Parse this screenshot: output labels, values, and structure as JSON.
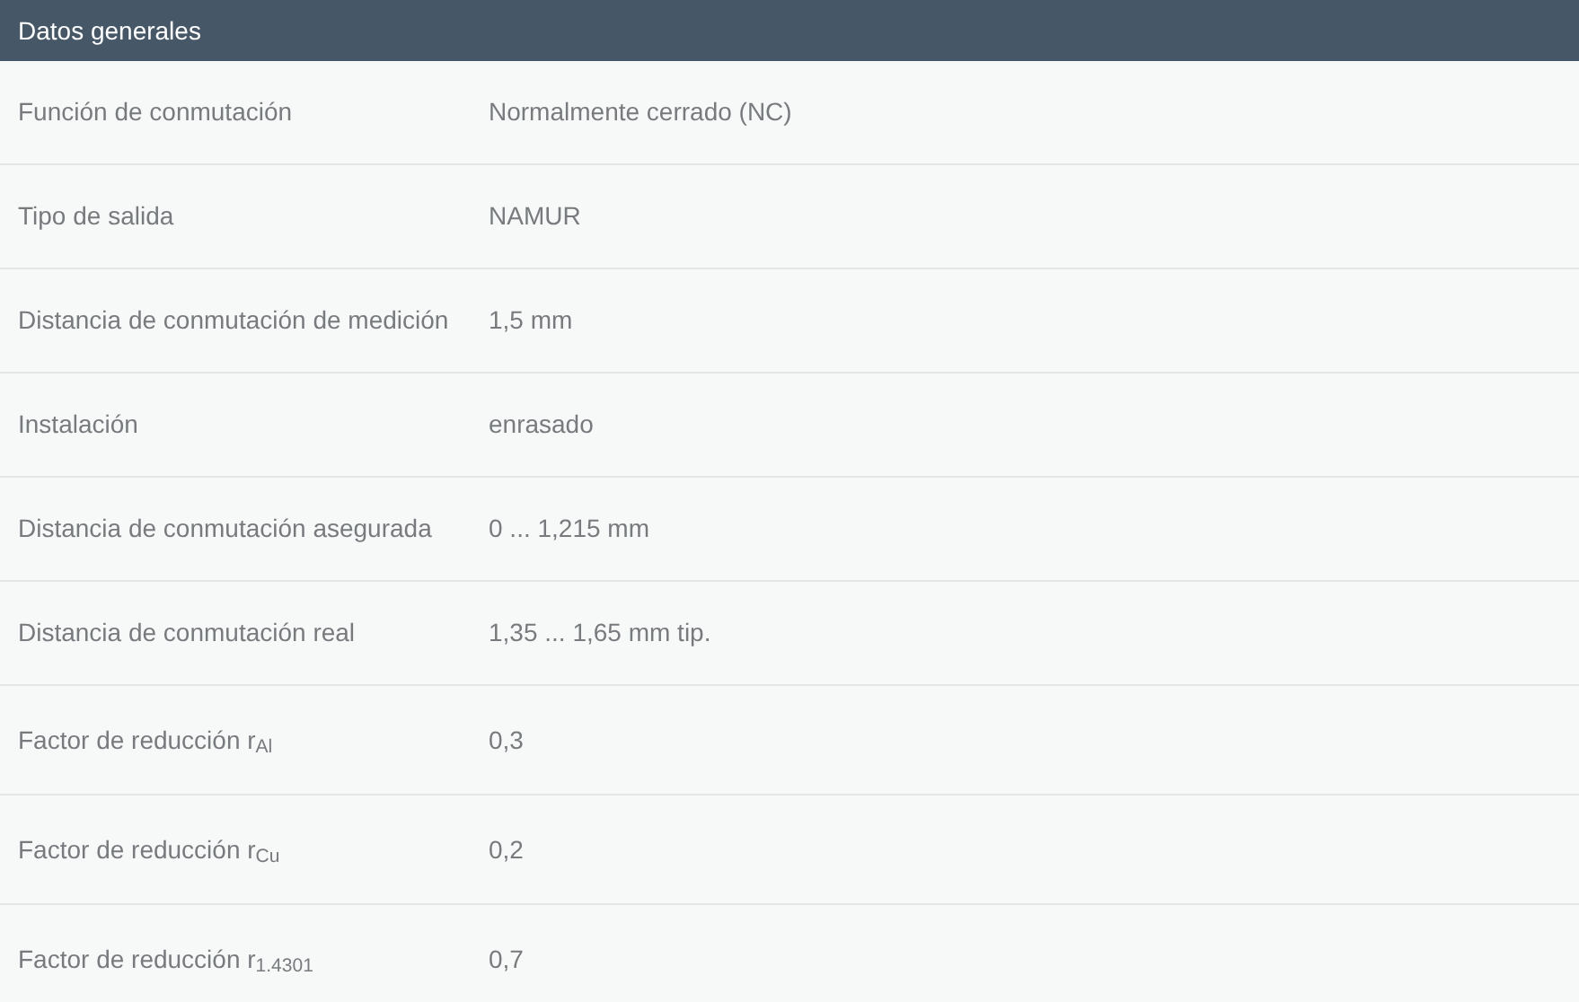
{
  "header": {
    "title": "Datos generales"
  },
  "rows": [
    {
      "label": "Función de conmutación",
      "value": "Normalmente cerrado (NC)"
    },
    {
      "label": "Tipo de salida",
      "value": "NAMUR"
    },
    {
      "label": "Distancia de conmutación de medición",
      "value": "1,5 mm"
    },
    {
      "label": "Instalación",
      "value": "enrasado"
    },
    {
      "label": "Distancia de conmutación asegurada",
      "value": "0 ... 1,215 mm"
    },
    {
      "label": "Distancia de conmutación real",
      "value": "1,35 ... 1,65 mm tip."
    },
    {
      "label": "Factor de reducción r$_{Al}$",
      "value": "0,3"
    },
    {
      "label": "Factor de reducción r$_{Cu}$",
      "value": "0,2"
    },
    {
      "label": "Factor de reducción r$_{1.4301}$",
      "value": "0,7"
    }
  ]
}
